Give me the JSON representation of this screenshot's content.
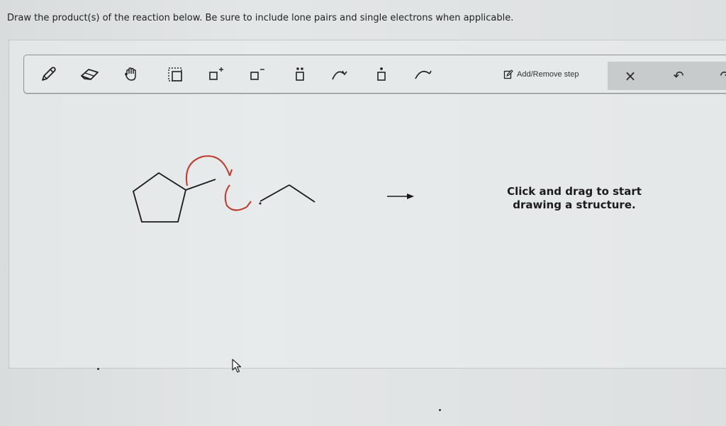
{
  "question": {
    "text": "Draw the product(s) of the reaction below. Be sure to include lone pairs and single electrons when applicable."
  },
  "toolbar": {
    "tools": [
      {
        "id": "pencil",
        "icon": "pencil-icon"
      },
      {
        "id": "eraser",
        "icon": "eraser-icon"
      },
      {
        "id": "hand",
        "icon": "hand-icon"
      },
      {
        "id": "select",
        "icon": "select-box-icon"
      },
      {
        "id": "positive-charge",
        "icon": "positive-charge-icon"
      },
      {
        "id": "negative-charge",
        "icon": "negative-charge-icon"
      },
      {
        "id": "lone-pair",
        "icon": "lone-pair-icon"
      },
      {
        "id": "pair-arrow",
        "icon": "curved-arrow-icon"
      },
      {
        "id": "radical",
        "icon": "radical-icon"
      },
      {
        "id": "single-electron-arrow",
        "icon": "fishhook-arrow-icon"
      }
    ],
    "add_remove_step_label": "Add/Remove step",
    "right_buttons": [
      {
        "id": "clear",
        "label": "×"
      },
      {
        "id": "undo",
        "label": "↶"
      },
      {
        "id": "redo",
        "label": "↷"
      }
    ]
  },
  "canvas": {
    "hint_line1": "Click and drag to start",
    "hint_line2": "drawing a structure."
  },
  "colors": {
    "mechanism_arrow": "#c0392b",
    "bond": "#1a1a1a",
    "background": "#dfe2e3"
  }
}
